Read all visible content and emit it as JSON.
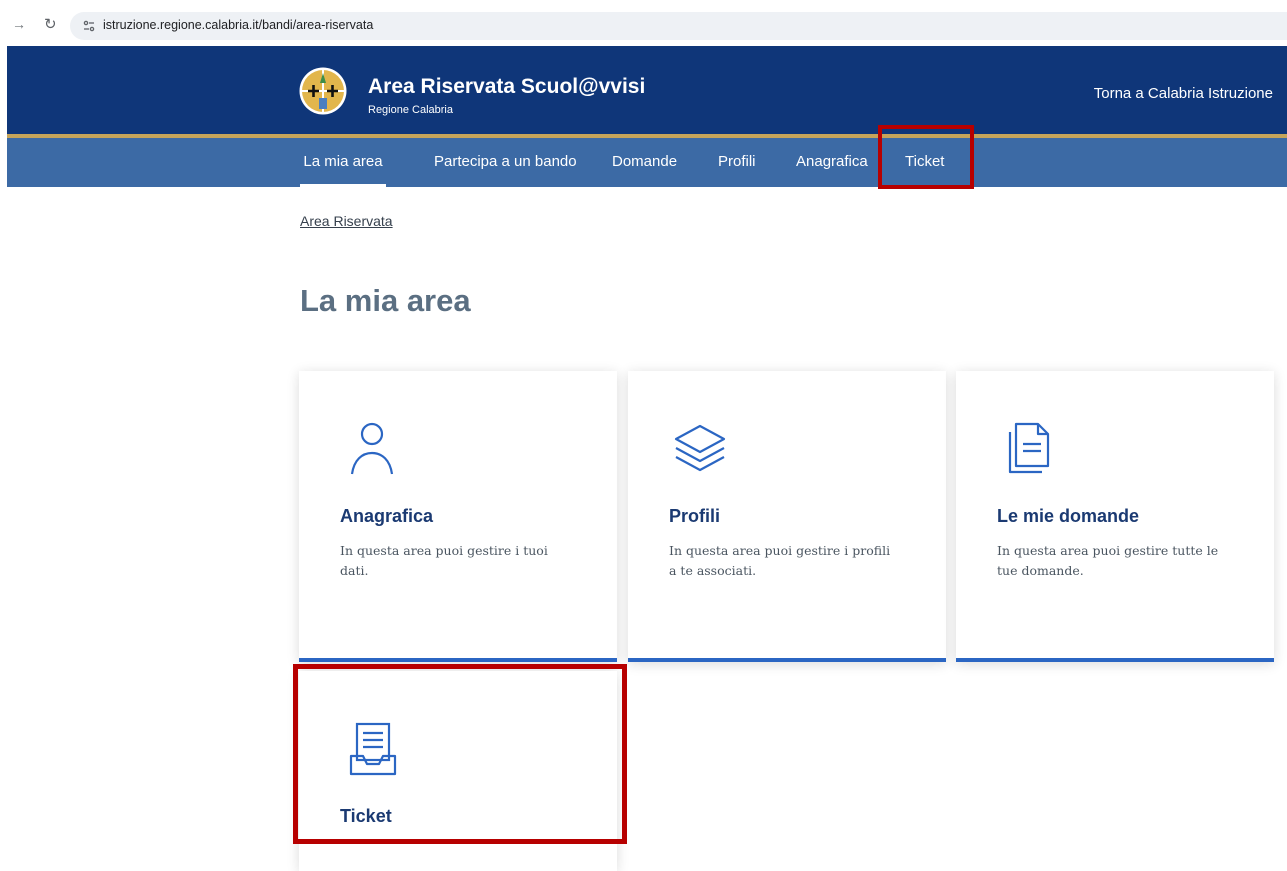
{
  "browser": {
    "url": "istruzione.regione.calabria.it/bandi/area-riservata"
  },
  "header": {
    "title": "Area Riservata Scuol@vvisi",
    "subtitle": "Regione Calabria",
    "back_link": "Torna a Calabria Istruzione"
  },
  "nav": {
    "items": [
      {
        "label": "La mia area"
      },
      {
        "label": "Partecipa a un bando"
      },
      {
        "label": "Domande"
      },
      {
        "label": "Profili"
      },
      {
        "label": "Anagrafica"
      },
      {
        "label": "Ticket"
      }
    ]
  },
  "breadcrumb": "Area Riservata",
  "page_title": "La mia area",
  "cards": [
    {
      "icon": "user-icon",
      "title": "Anagrafica",
      "description": "In questa area puoi gestire i tuoi dati."
    },
    {
      "icon": "layers-icon",
      "title": "Profili",
      "description": "In questa area puoi gestire i profili a te associati."
    },
    {
      "icon": "documents-icon",
      "title": "Le mie domande",
      "description": "In questa area puoi gestire tutte le tue domande."
    },
    {
      "icon": "ticket-tray-icon",
      "title": "Ticket",
      "description": ""
    }
  ],
  "colors": {
    "header_bg": "#0f3679",
    "nav_bg": "#3c6aa5",
    "gold": "#c5a45a",
    "card_accent": "#2b66c3",
    "highlight": "#b70000"
  }
}
